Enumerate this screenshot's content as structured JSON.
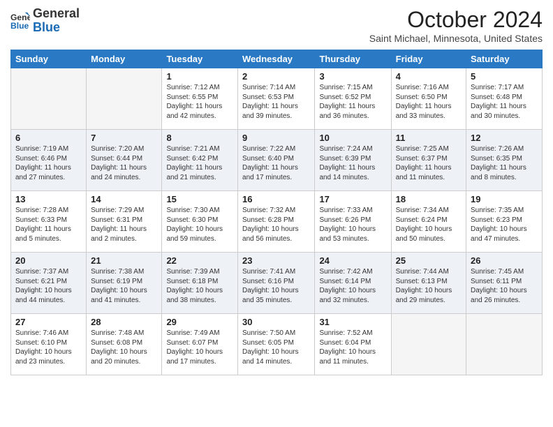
{
  "header": {
    "logo_line1": "General",
    "logo_line2": "Blue",
    "month": "October 2024",
    "location": "Saint Michael, Minnesota, United States"
  },
  "days_of_week": [
    "Sunday",
    "Monday",
    "Tuesday",
    "Wednesday",
    "Thursday",
    "Friday",
    "Saturday"
  ],
  "weeks": [
    [
      {
        "num": "",
        "info": ""
      },
      {
        "num": "",
        "info": ""
      },
      {
        "num": "1",
        "info": "Sunrise: 7:12 AM\nSunset: 6:55 PM\nDaylight: 11 hours and 42 minutes."
      },
      {
        "num": "2",
        "info": "Sunrise: 7:14 AM\nSunset: 6:53 PM\nDaylight: 11 hours and 39 minutes."
      },
      {
        "num": "3",
        "info": "Sunrise: 7:15 AM\nSunset: 6:52 PM\nDaylight: 11 hours and 36 minutes."
      },
      {
        "num": "4",
        "info": "Sunrise: 7:16 AM\nSunset: 6:50 PM\nDaylight: 11 hours and 33 minutes."
      },
      {
        "num": "5",
        "info": "Sunrise: 7:17 AM\nSunset: 6:48 PM\nDaylight: 11 hours and 30 minutes."
      }
    ],
    [
      {
        "num": "6",
        "info": "Sunrise: 7:19 AM\nSunset: 6:46 PM\nDaylight: 11 hours and 27 minutes."
      },
      {
        "num": "7",
        "info": "Sunrise: 7:20 AM\nSunset: 6:44 PM\nDaylight: 11 hours and 24 minutes."
      },
      {
        "num": "8",
        "info": "Sunrise: 7:21 AM\nSunset: 6:42 PM\nDaylight: 11 hours and 21 minutes."
      },
      {
        "num": "9",
        "info": "Sunrise: 7:22 AM\nSunset: 6:40 PM\nDaylight: 11 hours and 17 minutes."
      },
      {
        "num": "10",
        "info": "Sunrise: 7:24 AM\nSunset: 6:39 PM\nDaylight: 11 hours and 14 minutes."
      },
      {
        "num": "11",
        "info": "Sunrise: 7:25 AM\nSunset: 6:37 PM\nDaylight: 11 hours and 11 minutes."
      },
      {
        "num": "12",
        "info": "Sunrise: 7:26 AM\nSunset: 6:35 PM\nDaylight: 11 hours and 8 minutes."
      }
    ],
    [
      {
        "num": "13",
        "info": "Sunrise: 7:28 AM\nSunset: 6:33 PM\nDaylight: 11 hours and 5 minutes."
      },
      {
        "num": "14",
        "info": "Sunrise: 7:29 AM\nSunset: 6:31 PM\nDaylight: 11 hours and 2 minutes."
      },
      {
        "num": "15",
        "info": "Sunrise: 7:30 AM\nSunset: 6:30 PM\nDaylight: 10 hours and 59 minutes."
      },
      {
        "num": "16",
        "info": "Sunrise: 7:32 AM\nSunset: 6:28 PM\nDaylight: 10 hours and 56 minutes."
      },
      {
        "num": "17",
        "info": "Sunrise: 7:33 AM\nSunset: 6:26 PM\nDaylight: 10 hours and 53 minutes."
      },
      {
        "num": "18",
        "info": "Sunrise: 7:34 AM\nSunset: 6:24 PM\nDaylight: 10 hours and 50 minutes."
      },
      {
        "num": "19",
        "info": "Sunrise: 7:35 AM\nSunset: 6:23 PM\nDaylight: 10 hours and 47 minutes."
      }
    ],
    [
      {
        "num": "20",
        "info": "Sunrise: 7:37 AM\nSunset: 6:21 PM\nDaylight: 10 hours and 44 minutes."
      },
      {
        "num": "21",
        "info": "Sunrise: 7:38 AM\nSunset: 6:19 PM\nDaylight: 10 hours and 41 minutes."
      },
      {
        "num": "22",
        "info": "Sunrise: 7:39 AM\nSunset: 6:18 PM\nDaylight: 10 hours and 38 minutes."
      },
      {
        "num": "23",
        "info": "Sunrise: 7:41 AM\nSunset: 6:16 PM\nDaylight: 10 hours and 35 minutes."
      },
      {
        "num": "24",
        "info": "Sunrise: 7:42 AM\nSunset: 6:14 PM\nDaylight: 10 hours and 32 minutes."
      },
      {
        "num": "25",
        "info": "Sunrise: 7:44 AM\nSunset: 6:13 PM\nDaylight: 10 hours and 29 minutes."
      },
      {
        "num": "26",
        "info": "Sunrise: 7:45 AM\nSunset: 6:11 PM\nDaylight: 10 hours and 26 minutes."
      }
    ],
    [
      {
        "num": "27",
        "info": "Sunrise: 7:46 AM\nSunset: 6:10 PM\nDaylight: 10 hours and 23 minutes."
      },
      {
        "num": "28",
        "info": "Sunrise: 7:48 AM\nSunset: 6:08 PM\nDaylight: 10 hours and 20 minutes."
      },
      {
        "num": "29",
        "info": "Sunrise: 7:49 AM\nSunset: 6:07 PM\nDaylight: 10 hours and 17 minutes."
      },
      {
        "num": "30",
        "info": "Sunrise: 7:50 AM\nSunset: 6:05 PM\nDaylight: 10 hours and 14 minutes."
      },
      {
        "num": "31",
        "info": "Sunrise: 7:52 AM\nSunset: 6:04 PM\nDaylight: 10 hours and 11 minutes."
      },
      {
        "num": "",
        "info": ""
      },
      {
        "num": "",
        "info": ""
      }
    ]
  ]
}
